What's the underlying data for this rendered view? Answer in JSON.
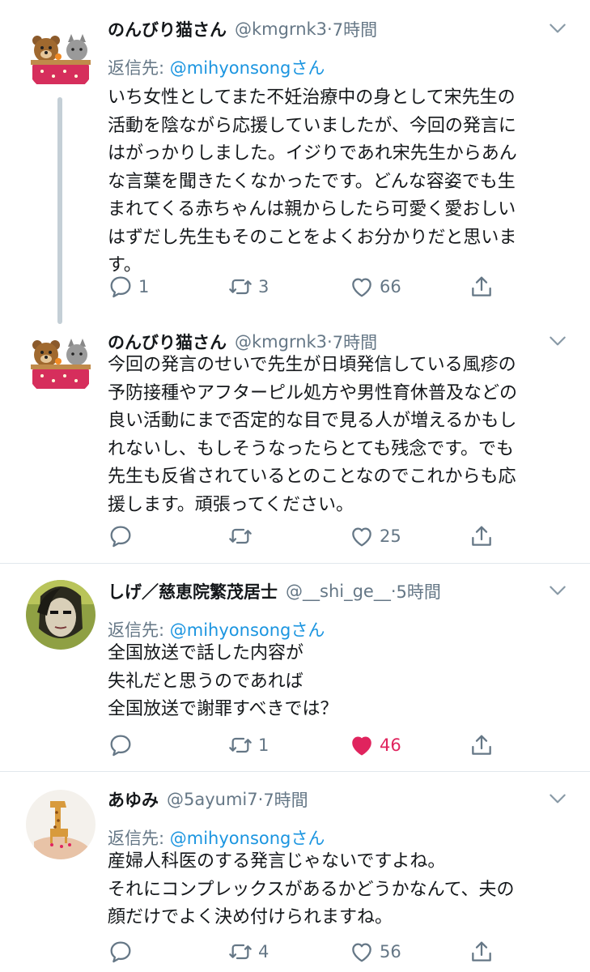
{
  "tweets": [
    {
      "name": "のんびり猫さん",
      "handle": "@kmgrnk3",
      "dot": "·",
      "time": "7時間",
      "reply_prefix": "返信先: ",
      "reply_user": "@mihyonsongさん",
      "text": "いち女性としてまた不妊治療中の身として宋先生の\n活動を陰ながら応援していましたが、今回の発言に\nはがっかりしました。イジりであれ宋先生からあん\nな言葉を聞きたくなかったです。どんな容姿でも生\nまれてくる赤ちゃんは親からしたら可愛く愛おしい\nはずだし先生もそのことをよくお分かりだと思いま\nす。",
      "reply_count": "1",
      "retweet_count": "3",
      "like_count": "66"
    },
    {
      "name": "のんびり猫さん",
      "handle": "@kmgrnk3",
      "dot": "·",
      "time": "7時間",
      "text": "今回の発言のせいで先生が日頃発信している風疹の\n予防接種やアフターピル処方や男性育休普及などの\n良い活動にまで否定的な目で見る人が増えるかもし\nれないし、もしそうなったらとても残念です。でも\n先生も反省されているとのことなのでこれからも応\n援します。頑張ってください。",
      "reply_count": "",
      "retweet_count": "",
      "like_count": "25"
    },
    {
      "name": "しげ／慈恵院繁茂居士",
      "handle": "@__shi_ge__",
      "dot": "·",
      "time": "5時間",
      "reply_prefix": "返信先: ",
      "reply_user": "@mihyonsongさん",
      "text": "全国放送で話した内容が\n失礼だと思うのであれば\n全国放送で謝罪すべきでは？",
      "reply_count": "",
      "retweet_count": "1",
      "like_count": "46"
    },
    {
      "name": "あゆみ",
      "handle": "@5ayumi7",
      "dot": "·",
      "time": "7時間",
      "reply_prefix": "返信先: ",
      "reply_user": "@mihyonsongさん",
      "text": "産婦人科医のする発言じゃないですよね。\nそれにコンプレックスがあるかどうかなんて、夫の\n顔だけでよく決め付けられますね。",
      "reply_count": "",
      "retweet_count": "4",
      "like_count": "56"
    }
  ],
  "icons": {
    "reply": "reply-icon",
    "retweet": "retweet-icon",
    "like": "heart-icon",
    "liked": "heart-filled-icon",
    "share": "share-icon",
    "more": "chevron-down-icon"
  },
  "colors": {
    "link": "#1b95e0",
    "secondary_text": "#657786",
    "like_active": "#e0245e",
    "thread_line": "#c4cfd6"
  }
}
